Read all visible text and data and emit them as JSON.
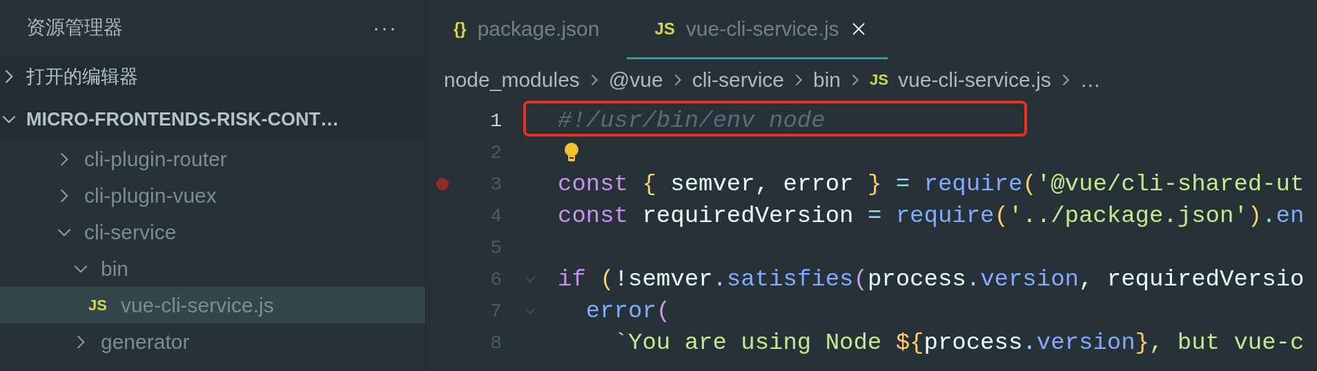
{
  "sidebar": {
    "title": "资源管理器",
    "more": "···",
    "sections": [
      {
        "label": "打开的编辑器",
        "expanded": false,
        "bold": false
      },
      {
        "label": "MICRO-FRONTENDS-RISK-CONT…",
        "expanded": true,
        "bold": true,
        "children": [
          {
            "label": "cli-plugin-router",
            "kind": "folder",
            "expanded": false,
            "selected": false
          },
          {
            "label": "cli-plugin-vuex",
            "kind": "folder",
            "expanded": false,
            "selected": false
          },
          {
            "label": "cli-service",
            "kind": "folder",
            "expanded": true,
            "selected": false,
            "children": [
              {
                "label": "bin",
                "kind": "folder",
                "expanded": true,
                "selected": false,
                "children": [
                  {
                    "label": "vue-cli-service.js",
                    "kind": "file",
                    "icon_text": "JS",
                    "selected": true
                  }
                ]
              },
              {
                "label": "generator",
                "kind": "folder",
                "expanded": false,
                "selected": false
              }
            ]
          }
        ]
      }
    ]
  },
  "tabs": [
    {
      "label": "package.json",
      "icon_text": "{}",
      "selected": false,
      "closable": false
    },
    {
      "label": "vue-cli-service.js",
      "icon_text": "JS",
      "selected": true,
      "closable": true
    }
  ],
  "breadcrumb": {
    "items": [
      {
        "label": "node_modules"
      },
      {
        "label": "@vue"
      },
      {
        "label": "cli-service"
      },
      {
        "label": "bin"
      },
      {
        "label": "vue-cli-service.js",
        "icon_text": "JS"
      }
    ],
    "more": "…"
  },
  "code": {
    "lines": [
      {
        "number": "1",
        "active": true,
        "breakpoint": false,
        "foldable": false,
        "lightbulb": false,
        "highlighted": true,
        "tokens": [
          {
            "kind": "comment",
            "text": "#!/usr/bin/env node"
          }
        ]
      },
      {
        "number": "2",
        "active": false,
        "breakpoint": false,
        "foldable": false,
        "lightbulb": true,
        "highlighted": false
      },
      {
        "number": "3",
        "active": false,
        "breakpoint": true,
        "foldable": false,
        "lightbulb": false,
        "highlighted": false,
        "tokens": [
          {
            "kind": "keyword",
            "text": "const"
          },
          {
            "kind": "brace",
            "text": " {"
          },
          {
            "kind": "plain",
            "text": " semver, error "
          },
          {
            "kind": "brace",
            "text": "}"
          },
          {
            "kind": "operator",
            "text": " = "
          },
          {
            "kind": "func",
            "text": "require"
          },
          {
            "kind": "brace",
            "text": "("
          },
          {
            "kind": "string",
            "text": "'@vue/cli-shared-ut"
          }
        ]
      },
      {
        "number": "4",
        "active": false,
        "breakpoint": false,
        "foldable": false,
        "lightbulb": false,
        "highlighted": false,
        "tokens": [
          {
            "kind": "keyword",
            "text": "const"
          },
          {
            "kind": "plain",
            "text": " requiredVersion "
          },
          {
            "kind": "operator",
            "text": "= "
          },
          {
            "kind": "func",
            "text": "require"
          },
          {
            "kind": "brace",
            "text": "("
          },
          {
            "kind": "string",
            "text": "'../package.json'"
          },
          {
            "kind": "brace",
            "text": ")"
          },
          {
            "kind": "operator",
            "text": "."
          },
          {
            "kind": "func",
            "text": "en"
          }
        ]
      },
      {
        "number": "5",
        "active": false,
        "breakpoint": false,
        "foldable": false,
        "lightbulb": false,
        "highlighted": false
      },
      {
        "number": "6",
        "active": false,
        "breakpoint": false,
        "foldable": true,
        "lightbulb": false,
        "highlighted": false,
        "tokens": [
          {
            "kind": "keyword",
            "text": "if"
          },
          {
            "kind": "brace",
            "text": " ("
          },
          {
            "kind": "plain",
            "text": "!semver"
          },
          {
            "kind": "operator",
            "text": "."
          },
          {
            "kind": "func",
            "text": "satisfies"
          },
          {
            "kind": "paren",
            "text": "("
          },
          {
            "kind": "plain",
            "text": "process"
          },
          {
            "kind": "operator",
            "text": "."
          },
          {
            "kind": "func",
            "text": "version"
          },
          {
            "kind": "plain",
            "text": ", requiredVersio"
          }
        ]
      },
      {
        "number": "7",
        "active": false,
        "breakpoint": false,
        "foldable": true,
        "lightbulb": false,
        "highlighted": false,
        "tokens": [
          {
            "kind": "func",
            "text": "  error"
          },
          {
            "kind": "paren",
            "text": "("
          }
        ]
      },
      {
        "number": "8",
        "active": false,
        "breakpoint": false,
        "foldable": false,
        "lightbulb": false,
        "highlighted": false,
        "tokens": [
          {
            "kind": "string",
            "text": "    `You are using Node "
          },
          {
            "kind": "template",
            "text": "${"
          },
          {
            "kind": "plain",
            "text": "process"
          },
          {
            "kind": "operator",
            "text": "."
          },
          {
            "kind": "func",
            "text": "version"
          },
          {
            "kind": "template",
            "text": "}"
          },
          {
            "kind": "string",
            "text": ", but vue-c"
          }
        ]
      }
    ]
  }
}
